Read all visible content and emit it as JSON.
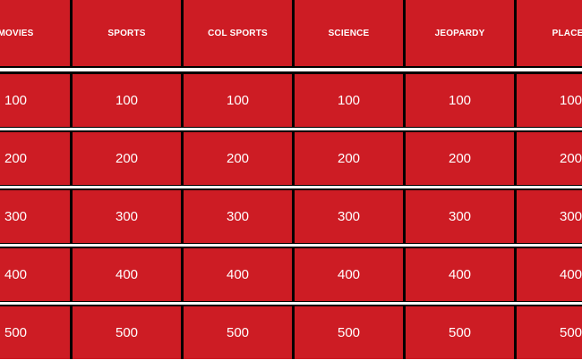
{
  "board": {
    "categories": [
      "MOVIES",
      "SPORTS",
      "COL SPORTS",
      "SCIENCE",
      "JEOPARDY",
      "PLACES"
    ],
    "values": [
      "100",
      "200",
      "300",
      "400",
      "500"
    ],
    "colors": {
      "tile": "#cd1c24",
      "text": "#ffffff",
      "grid": "#000000",
      "separator": "#ffffff"
    }
  }
}
